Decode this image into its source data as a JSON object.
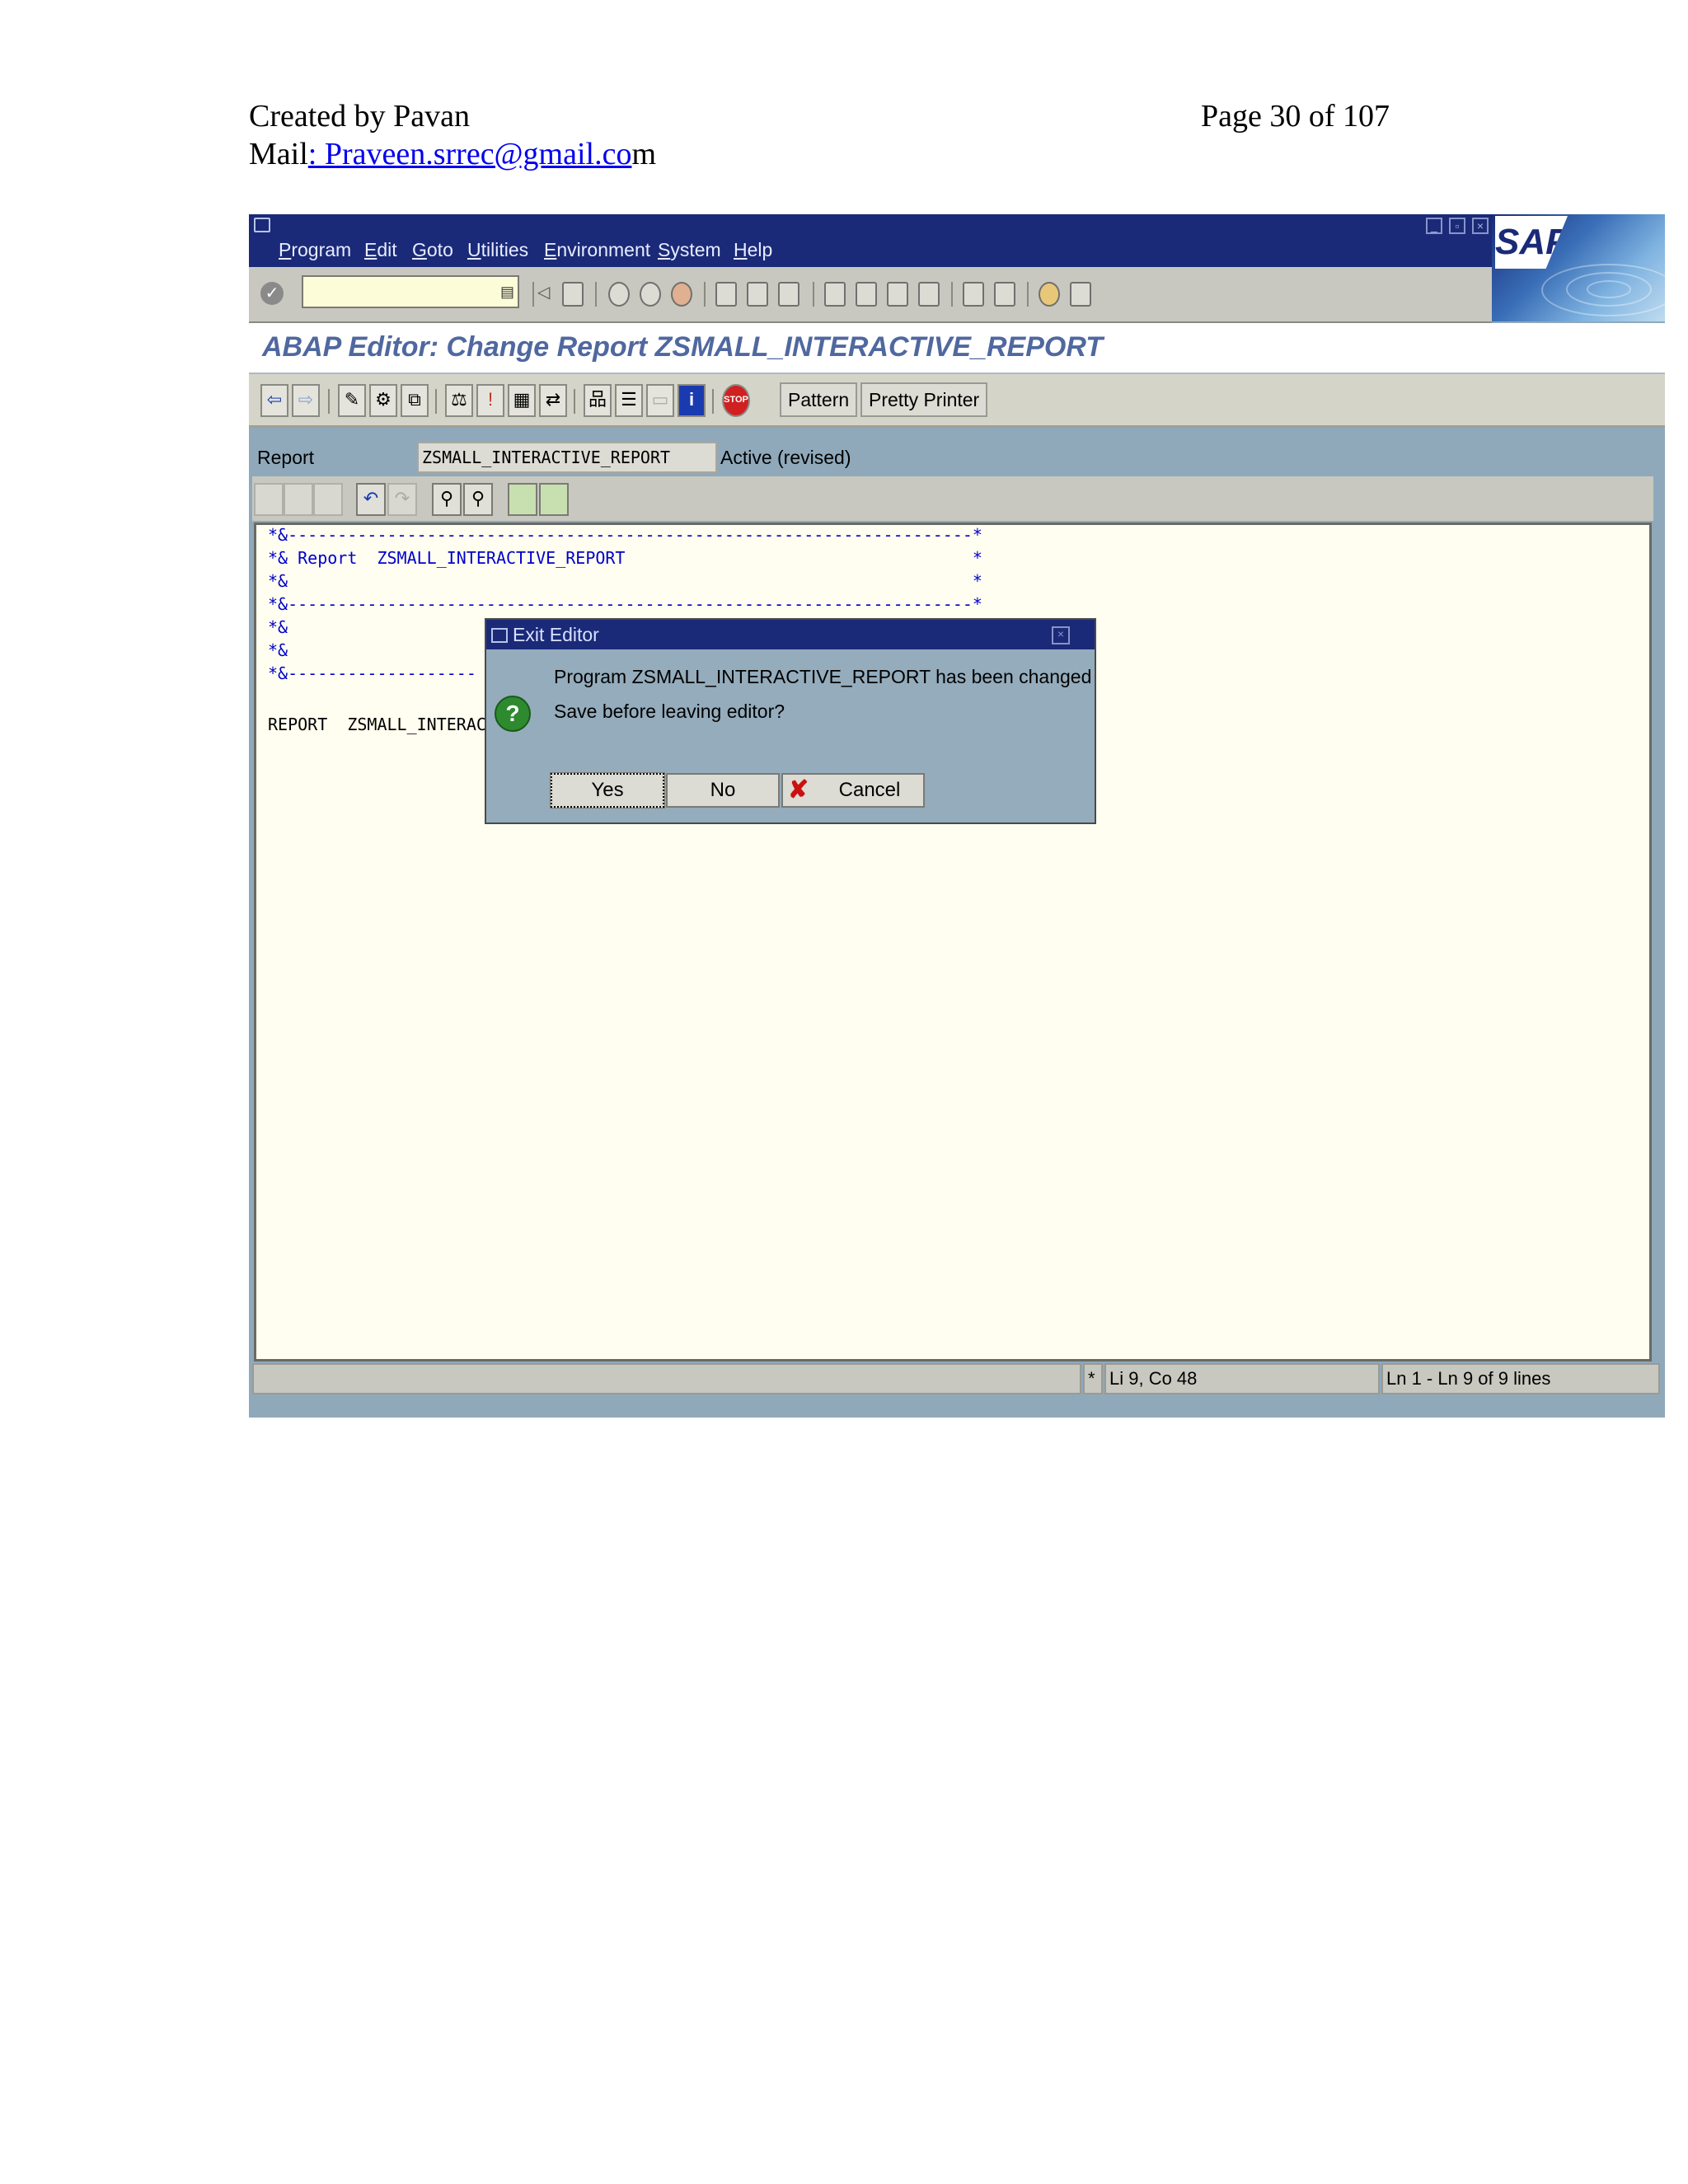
{
  "doc": {
    "created_by": "Created by  Pavan",
    "page": "Page 30 of 107",
    "mail_prefix": "Mail",
    "mail_link": ": Praveen.srrec@gmail.co",
    "mail_suffix": "m"
  },
  "menubar": {
    "items": [
      "Program",
      "Edit",
      "Goto",
      "Utilities",
      "Environment",
      "System",
      "Help"
    ],
    "logo": "SAP"
  },
  "window": {
    "title": "ABAP Editor: Change Report ZSMALL_INTERACTIVE_REPORT"
  },
  "app_toolbar": {
    "pattern_label": "Pattern",
    "pretty_printer_label": "Pretty Printer"
  },
  "report": {
    "label": "Report",
    "value": "ZSMALL_INTERACTIVE_REPORT",
    "status": "Active (revised)"
  },
  "editor": {
    "lines": [
      "*&---------------------------------------------------------------------*",
      "*& Report  ZSMALL_INTERACTIVE_REPORT                                   *",
      "*&                                                                     *",
      "*&---------------------------------------------------------------------*",
      "*&",
      "*&",
      "*&-------------------",
      "",
      "REPORT  ZSMALL_INTERACT"
    ]
  },
  "statusbar": {
    "mark": "*",
    "position": "Li 9, Co 48",
    "lines": "Ln 1 - Ln 9 of 9 lines"
  },
  "dialog": {
    "title": "Exit Editor",
    "message1": "Program ZSMALL_INTERACTIVE_REPORT has been changed",
    "message2": "Save before leaving editor?",
    "yes": "Yes",
    "no": "No",
    "cancel": "Cancel"
  }
}
